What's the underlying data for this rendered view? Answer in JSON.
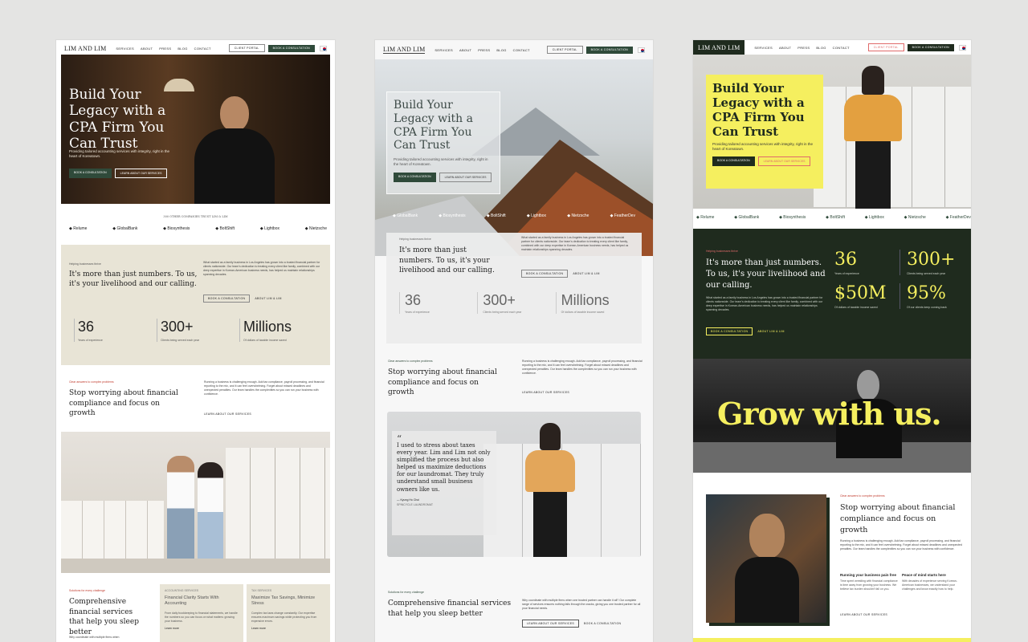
{
  "brand": "LIM AND LIM",
  "nav": {
    "services": "SERVICES",
    "about": "ABOUT",
    "press": "PRESS",
    "blog": "BLOG",
    "contact": "CONTACT",
    "portal": "CLIENT PORTAL",
    "book": "BOOK A CONSULTATION"
  },
  "hero": {
    "title": "Build Your Legacy with a CPA Firm You Can Trust",
    "subtitle": "Providing tailored accounting services with integrity, right in the heart of Koreatown.",
    "cta_primary": "BOOK A CONSULTATION",
    "cta_secondary": "LEARN ABOUT OUR SERVICES"
  },
  "trust": "300 OTHER COMPANIES TRUST LIM & LIM",
  "logos_a": [
    "Relume",
    "GlobalBank",
    "Biosynthesis",
    "BoltShift",
    "Lightbox",
    "Nietzsche"
  ],
  "logos_b": [
    "GlobalBank",
    "Biosynthesis",
    "BoltShift",
    "Lightbox",
    "Nietzsche",
    "FeatherDev"
  ],
  "logos_c": [
    "Relume",
    "GlobalBank",
    "Biosynthesis",
    "BoltShift",
    "Lightbox",
    "Nietzsche",
    "FeatherDev"
  ],
  "about": {
    "label": "Helping businesses thrive",
    "heading": "It's more than just numbers. To us, it's your livelihood and our calling.",
    "body": "What started as a family business in Los Angeles has grown into a trusted financial partner for clients nationwide. Our team's dedication to treating every client like family, combined with our deep expertise in Korean-American business needs, has helped us maintain relationships spanning decades.",
    "cta_book": "BOOK A CONSULTATION",
    "cta_about": "ABOUT LIM & LIM"
  },
  "stats": [
    {
      "value": "36",
      "label": "Years of experience"
    },
    {
      "value": "300+",
      "label": "Clients being served each year"
    },
    {
      "value": "Millions",
      "label": "Of dollars of taxable income saved"
    }
  ],
  "stats_c": [
    {
      "value": "36",
      "label": "Years of experience"
    },
    {
      "value": "300+",
      "label": "Clients being served each year"
    },
    {
      "value": "$50M",
      "label": "Of dollars of taxable income saved"
    },
    {
      "value": "95%",
      "label": "Of our clients keep coming back"
    }
  ],
  "problems": {
    "label": "Clear answers to complex problems",
    "heading": "Stop worrying about financial compliance and focus on growth",
    "body": "Running a business is challenging enough. Add tax compliance, payroll processing, and financial reporting to the mix, and it can feel overwhelming. Forget about missed deadlines and unexpected penalties. Our team handles the complexities so you can run your business with confidence.",
    "link": "LEARN ABOUT OUR SERVICES"
  },
  "quote": {
    "text": "I used to stress about taxes every year. Lim and Lim not only simplified the process but also helped us maximize deductions for our laundromat. They truly understand small business owners like us.",
    "author": "— Kyung Ho Choi",
    "company": "SPINCYCLE LAUNDROMAT"
  },
  "solutions": {
    "label": "Solutions for every challenge",
    "heading": "Comprehensive financial services that help you sleep better",
    "body": "Why coordinate with multiple firms when one trusted partner can handle it all? Our complete range of services ensures nothing falls through the cracks, giving you one trusted partner for all your financial needs.",
    "body_short": "Why coordinate with multiple firms when",
    "link": "LEARN ABOUT OUR SERVICES",
    "book": "BOOK A CONSULTATION"
  },
  "cards": [
    {
      "tag": "ACCOUNTING SERVICES",
      "title": "Financial Clarity Starts With Accounting",
      "body": "From daily bookkeeping to financial statements, we handle the numbers so you can focus on what matters: growing your business.",
      "more": "Learn more"
    },
    {
      "tag": "TAX SERVICES",
      "title": "Maximize Tax Savings, Minimize Stress",
      "body": "Complex tax laws change constantly. Our expertise ensures maximum savings while protecting you from expensive errors.",
      "more": "Learn more"
    }
  ],
  "grow": "Grow with us.",
  "features": [
    {
      "title": "Running your business pain free",
      "body": "Time spent wrestling with financial compliance is time away from growing your business. We believe tax burden shouldn't fall on you."
    },
    {
      "title": "Peace of mind starts here",
      "body": "With decades of experience serving Korean-American businesses, we understand your challenges and know exactly how to help."
    }
  ],
  "colors": {
    "forest": "#2f4a3a",
    "dark_green": "#1f2b1e",
    "beige": "#e8e4d6",
    "yellow": "#f5ef5f",
    "accent_red": "#c0392b"
  }
}
